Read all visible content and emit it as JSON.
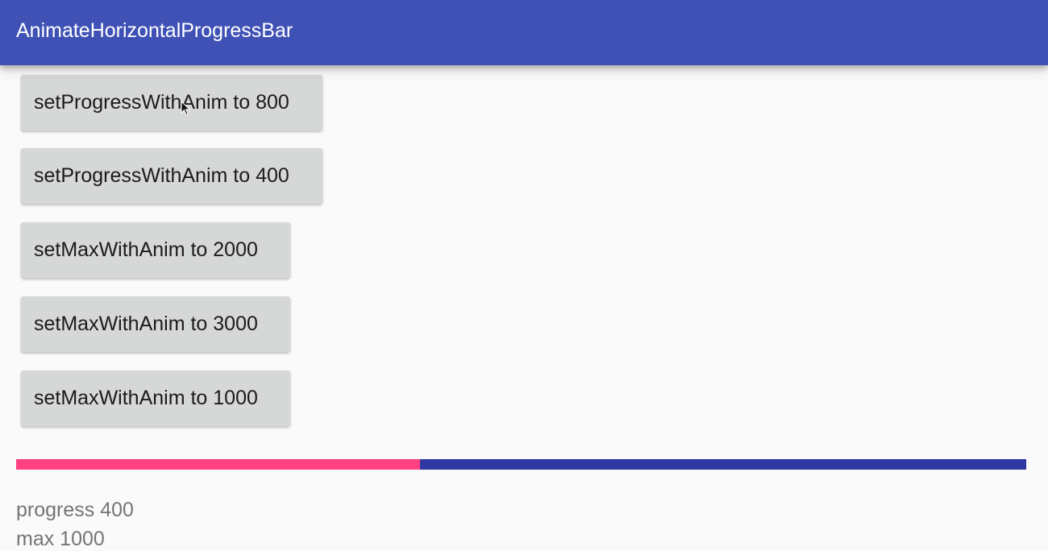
{
  "appbar": {
    "title": "AnimateHorizontalProgressBar",
    "color": "#3f51b5"
  },
  "buttons": [
    {
      "label": "setProgressWithAnim to 800"
    },
    {
      "label": "setProgressWithAnim to 400"
    },
    {
      "label": "setMaxWithAnim to 2000"
    },
    {
      "label": "setMaxWithAnim to 3000"
    },
    {
      "label": "setMaxWithAnim to 1000"
    }
  ],
  "progress": {
    "value": 400,
    "max": 1000,
    "fill_color": "#ff4081",
    "track_color": "#3038a3"
  },
  "info": {
    "progress_text": "progress 400",
    "max_text": "max 1000"
  },
  "cursor_icon": "mouse-pointer-icon"
}
